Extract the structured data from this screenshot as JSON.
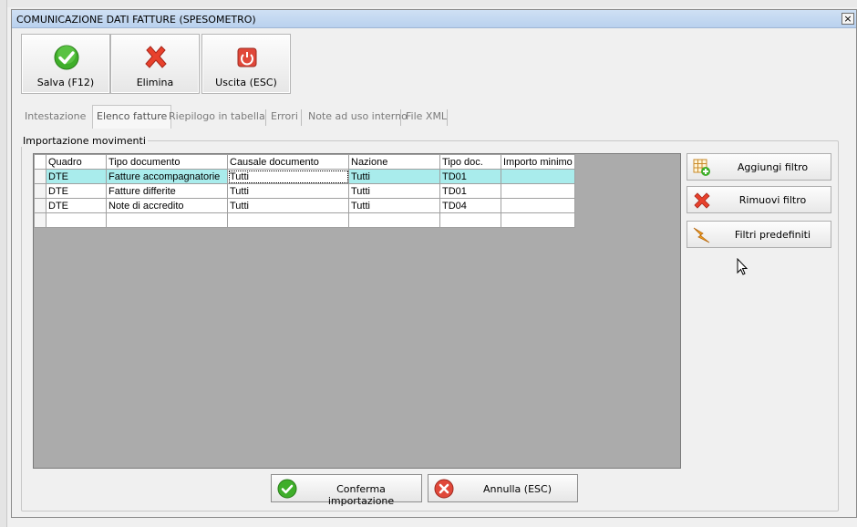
{
  "window": {
    "title": "COMUNICAZIONE DATI FATTURE (SPESOMETRO)",
    "close_glyph": "×"
  },
  "toolbar": {
    "save_label": "Salva (F12)",
    "delete_label": "Elimina",
    "exit_label": "Uscita (ESC)"
  },
  "tabs": [
    {
      "label": "Intestazione",
      "active": false
    },
    {
      "label": "Elenco fatture",
      "active": true
    },
    {
      "label": "Riepilogo in tabella",
      "active": false
    },
    {
      "label": "Errori",
      "active": false
    },
    {
      "label": "Note ad uso interno",
      "active": false
    },
    {
      "label": "File XML",
      "active": false
    }
  ],
  "group": {
    "legend": "Importazione movimenti"
  },
  "grid": {
    "columns": [
      "Quadro",
      "Tipo documento",
      "Causale documento",
      "Nazione",
      "Tipo doc.",
      "Importo minimo"
    ],
    "rows": [
      [
        "DTE",
        "Fatture accompagnatorie",
        "Tutti",
        "Tutti",
        "TD01",
        ""
      ],
      [
        "DTE",
        "Fatture differite",
        "Tutti",
        "Tutti",
        "TD01",
        ""
      ],
      [
        "DTE",
        "Note di accredito",
        "Tutti",
        "Tutti",
        "TD04",
        ""
      ],
      [
        "",
        "",
        "",
        "",
        "",
        ""
      ]
    ],
    "selected_row_index": 0
  },
  "side_buttons": {
    "add_filter_label": "Aggiungi filtro",
    "remove_filter_label": "Rimuovi filtro",
    "preset_filters_label": "Filtri predefiniti"
  },
  "bottom_buttons": {
    "confirm_label": "Conferma importazione",
    "cancel_label": "Annulla (ESC)"
  },
  "colors": {
    "selected_row": "#a9ecec",
    "ok_green": "#3fae2a",
    "delete_red": "#e8412c",
    "exit_red": "#e0483a"
  }
}
